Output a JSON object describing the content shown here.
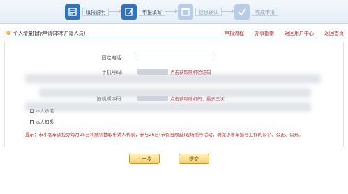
{
  "steps": [
    {
      "label": "填报说明",
      "state": "done",
      "icon": "book-icon"
    },
    {
      "label": "申报填写",
      "state": "done",
      "icon": "edit-form-icon"
    },
    {
      "label": "信息确认",
      "state": "todo",
      "icon": "window-icon"
    },
    {
      "label": "完成申报",
      "state": "todo",
      "icon": "checkmark-icon"
    }
  ],
  "header": {
    "title": "个人增量指标申请(本市户籍人员)",
    "links": [
      "申报流程",
      "办事指南",
      "返回用户中心",
      "返回首页"
    ]
  },
  "form": {
    "phone_label": "固定电话:",
    "phone_value": "",
    "mobile_label": "手机号码:",
    "mobile_link": "点击获取随机验证码",
    "random_label": "随机顺序码:",
    "random_link": "点击获取随机码，最多三次",
    "pledge_label": "本人承诺",
    "pledge_checked": false,
    "pledge2_label": "本人知悉",
    "pledge2_checked": false
  },
  "tip": "提示：市小客车调控办每月25日将随机抽取申请人代表，参与26日(节假日顺延)现场摇号活动，确保小客车摇号工作的公平、公正、公开。",
  "buttons": {
    "prev": "上一步",
    "submit": "提交"
  },
  "colors": {
    "accent": "#2f74c0",
    "link": "#c22f2f",
    "button": "#f4cf66"
  }
}
